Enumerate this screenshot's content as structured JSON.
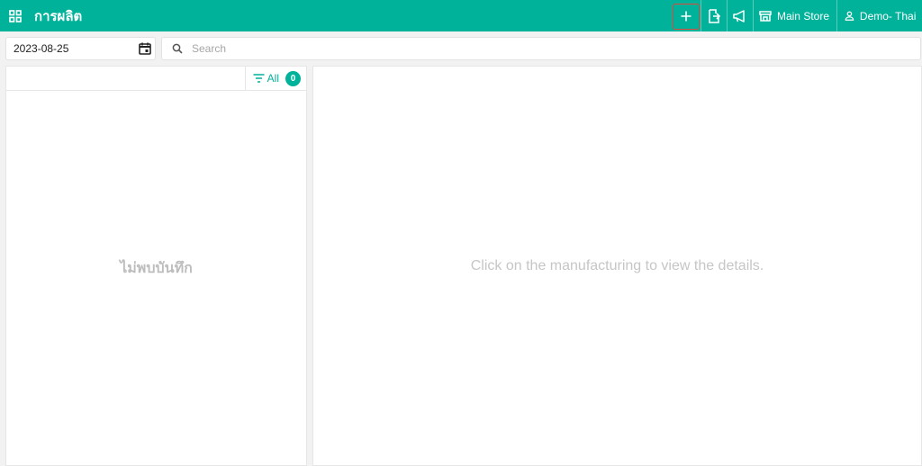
{
  "header": {
    "title": "การผลิต",
    "store_label": "Main Store",
    "user_label": "Demo- Thail..."
  },
  "filters": {
    "date_value": "2023-08-25",
    "search_placeholder": "Search"
  },
  "list": {
    "filter_label": "All",
    "count": "0",
    "empty_message": "ไม่พบบันทึก"
  },
  "detail": {
    "placeholder_message": "Click on the manufacturing to view the details."
  },
  "colors": {
    "brand": "#00b29a",
    "highlight": "#e0463c"
  }
}
